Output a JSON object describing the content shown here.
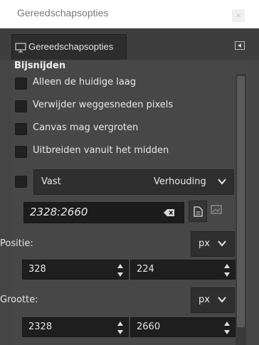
{
  "window": {
    "title": "Gereedschapsopties",
    "close_glyph": "×"
  },
  "tab": {
    "label": "Gereedschapsopties",
    "icon": "monitor-icon"
  },
  "section": {
    "title": "Bijsnijden"
  },
  "options": [
    {
      "label": "Alleen de huidige laag",
      "checked": false
    },
    {
      "label": "Verwijder weggesneden pixels",
      "checked": false
    },
    {
      "label": "Canvas mag vergroten",
      "checked": false
    },
    {
      "label": "Uitbreiden vanuit het midden",
      "checked": false
    }
  ],
  "fixed": {
    "label": "Vast",
    "checked": false,
    "mode": "Verhouding"
  },
  "ratio": {
    "value": "2328:2660"
  },
  "position": {
    "label": "Positie:",
    "unit": "px",
    "x": "328",
    "y": "224"
  },
  "size": {
    "label": "Grootte:",
    "unit": "px",
    "w": "2328",
    "h": "2660"
  }
}
